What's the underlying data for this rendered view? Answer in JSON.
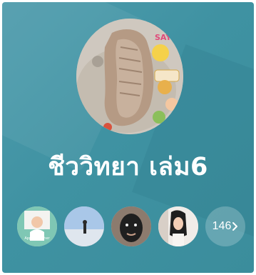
{
  "group": {
    "title": "ชีววิทยา เล่ม6"
  },
  "members": {
    "count_label": "146",
    "avatars": [
      {
        "name": "member-avatar-1",
        "caption": "Apple Teacher"
      },
      {
        "name": "member-avatar-2",
        "caption": ""
      },
      {
        "name": "member-avatar-3",
        "caption": ""
      },
      {
        "name": "member-avatar-4",
        "caption": ""
      }
    ]
  },
  "colors": {
    "background": "#4198a8",
    "text": "#ffffff"
  }
}
